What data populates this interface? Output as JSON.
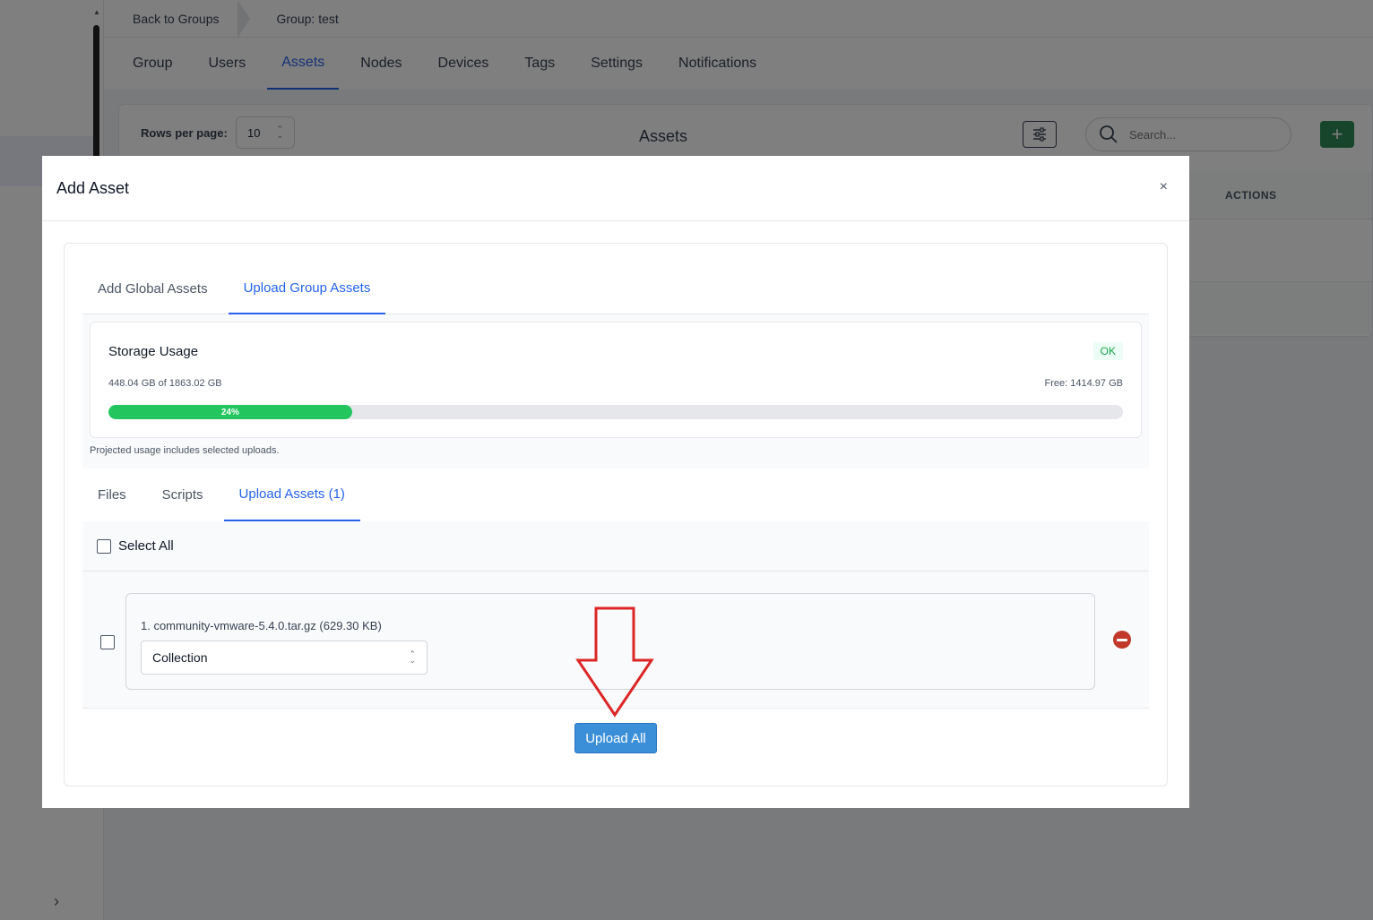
{
  "breadcrumb": {
    "back": "Back to Groups",
    "current": "Group: test"
  },
  "nav_tabs": [
    {
      "label": "Group"
    },
    {
      "label": "Users"
    },
    {
      "label": "Assets"
    },
    {
      "label": "Nodes"
    },
    {
      "label": "Devices"
    },
    {
      "label": "Tags"
    },
    {
      "label": "Settings"
    },
    {
      "label": "Notifications"
    }
  ],
  "nav_active": "Assets",
  "panel": {
    "rows_label": "Rows per page:",
    "rows_value": "10",
    "title": "Assets",
    "search_placeholder": "Search...",
    "add_label": "+",
    "actions_header": "ACTIONS"
  },
  "modal": {
    "title": "Add Asset",
    "close": "×",
    "tabs": [
      {
        "label": "Add Global Assets"
      },
      {
        "label": "Upload Group Assets"
      }
    ],
    "storage": {
      "title": "Storage Usage",
      "status": "OK",
      "usage": "448.04 GB of 1863.02 GB",
      "free": "Free: 1414.97 GB",
      "percent_label": "24%",
      "percent_value": 24,
      "note": "Projected usage includes selected uploads."
    },
    "sub_tabs": [
      {
        "label": "Files"
      },
      {
        "label": "Scripts"
      },
      {
        "label": "Upload Assets (1)"
      }
    ],
    "select_all": "Select All",
    "file": {
      "name": "1. community-vmware-5.4.0.tar.gz (629.30 KB)",
      "type": "Collection"
    },
    "upload_all": "Upload All"
  },
  "colors": {
    "accent": "#2563eb",
    "progress": "#22c55e",
    "add_button": "#2e8b57",
    "upload_button": "#3b8fd9",
    "remove": "#c0392b",
    "annotation": "#dc2626"
  }
}
